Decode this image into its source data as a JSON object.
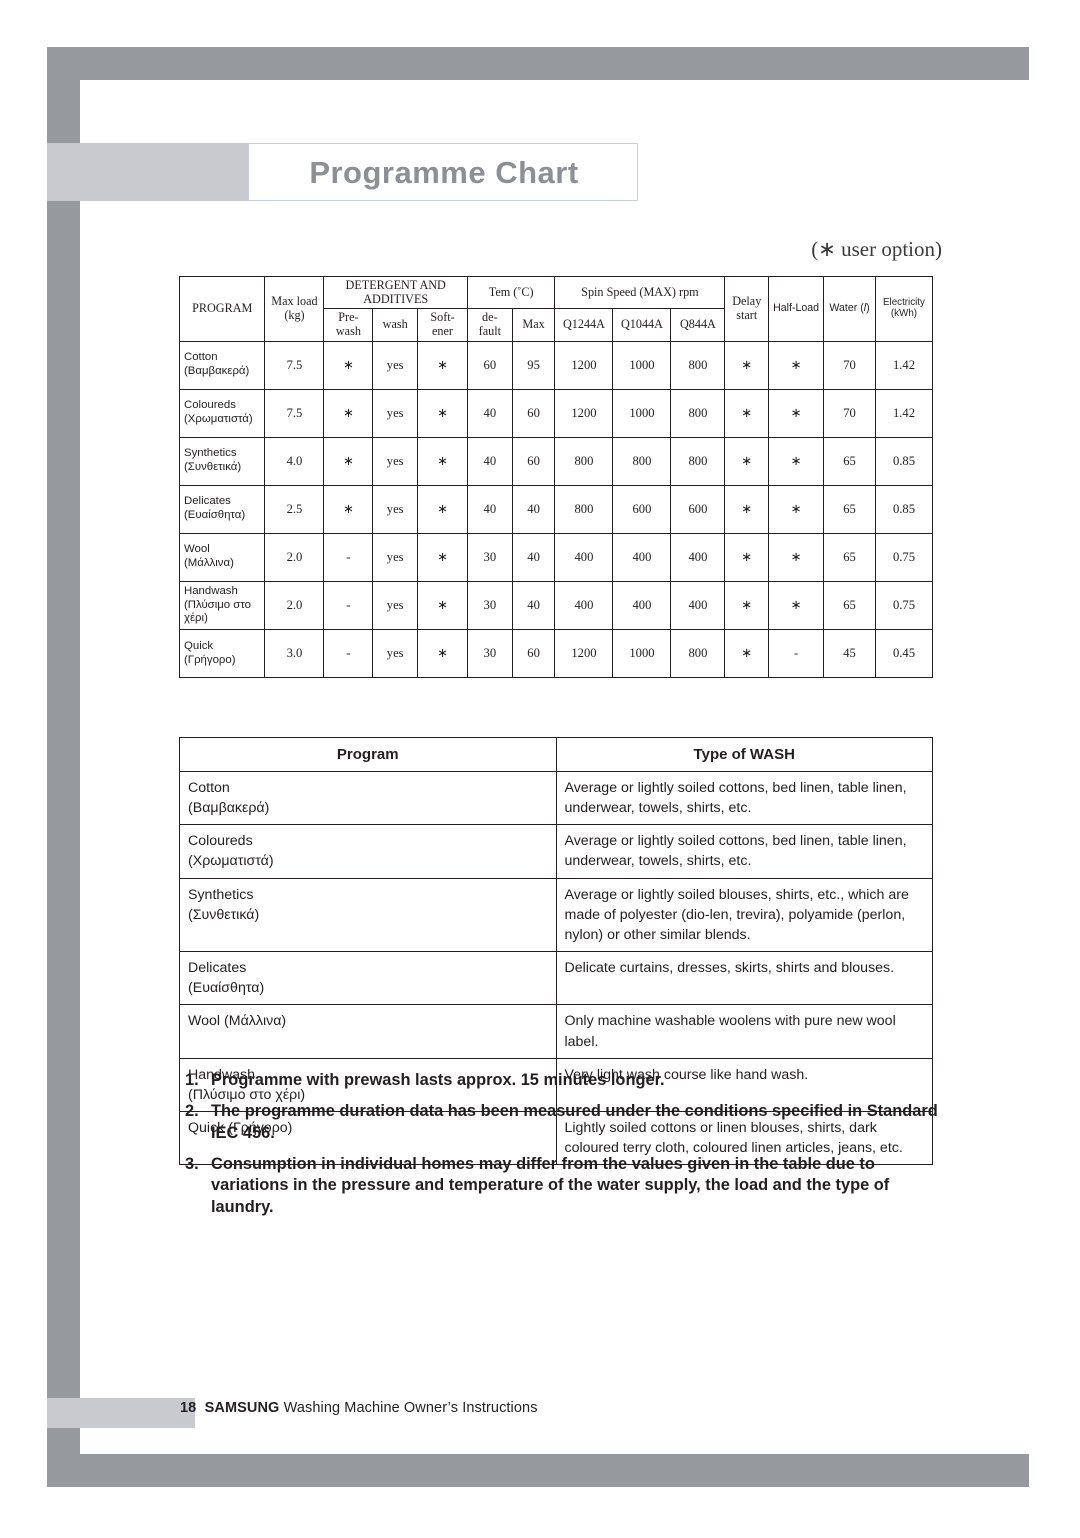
{
  "page": {
    "title": "Programme Chart",
    "user_option_note": "(∗ user option)",
    "footer_page_number": "18",
    "footer_brand": "SAMSUNG",
    "footer_text": "Washing Machine Owner’s Instructions"
  },
  "chart_data": {
    "type": "table",
    "title": "Programme Chart",
    "columns": [
      "PROGRAM",
      "Max load (kg)",
      "DETERGENT AND ADDITIVES / Pre-wash",
      "DETERGENT AND ADDITIVES / wash",
      "DETERGENT AND ADDITIVES / Soft-ener",
      "Tem (˚C) / de-fault",
      "Tem (˚C) / Max",
      "Spin Speed (MAX) rpm / Q1244A",
      "Spin Speed (MAX) rpm / Q1044A",
      "Spin Speed (MAX) rpm / Q844A",
      "Delay start",
      "Half-Load",
      "Water (l)",
      "Electricity (kWh)"
    ],
    "rows": [
      {
        "program_en": "Cotton",
        "program_gr": "(Βαμβακερά)",
        "max_load": "7.5",
        "prewash": "∗",
        "wash": "yes",
        "softener": "∗",
        "temp_default": "60",
        "temp_max": "95",
        "spin_q1244a": "1200",
        "spin_q1044a": "1000",
        "spin_q844a": "800",
        "delay_start": "∗",
        "half_load": "∗",
        "water": "70",
        "electricity": "1.42"
      },
      {
        "program_en": "Coloureds",
        "program_gr": "(Χρωματιστά)",
        "max_load": "7.5",
        "prewash": "∗",
        "wash": "yes",
        "softener": "∗",
        "temp_default": "40",
        "temp_max": "60",
        "spin_q1244a": "1200",
        "spin_q1044a": "1000",
        "spin_q844a": "800",
        "delay_start": "∗",
        "half_load": "∗",
        "water": "70",
        "electricity": "1.42"
      },
      {
        "program_en": "Synthetics",
        "program_gr": "(Συνθετικά)",
        "max_load": "4.0",
        "prewash": "∗",
        "wash": "yes",
        "softener": "∗",
        "temp_default": "40",
        "temp_max": "60",
        "spin_q1244a": "800",
        "spin_q1044a": "800",
        "spin_q844a": "800",
        "delay_start": "∗",
        "half_load": "∗",
        "water": "65",
        "electricity": "0.85"
      },
      {
        "program_en": "Delicates",
        "program_gr": "(Ευαίσθητα)",
        "max_load": "2.5",
        "prewash": "∗",
        "wash": "yes",
        "softener": "∗",
        "temp_default": "40",
        "temp_max": "40",
        "spin_q1244a": "800",
        "spin_q1044a": "600",
        "spin_q844a": "600",
        "delay_start": "∗",
        "half_load": "∗",
        "water": "65",
        "electricity": "0.85"
      },
      {
        "program_en": "Wool",
        "program_gr": "(Μάλλινα)",
        "max_load": "2.0",
        "prewash": "-",
        "wash": "yes",
        "softener": "∗",
        "temp_default": "30",
        "temp_max": "40",
        "spin_q1244a": "400",
        "spin_q1044a": "400",
        "spin_q844a": "400",
        "delay_start": "∗",
        "half_load": "∗",
        "water": "65",
        "electricity": "0.75"
      },
      {
        "program_en": "Handwash",
        "program_gr": "(Πλύσιμο στο χέρι)",
        "max_load": "2.0",
        "prewash": "-",
        "wash": "yes",
        "softener": "∗",
        "temp_default": "30",
        "temp_max": "40",
        "spin_q1244a": "400",
        "spin_q1044a": "400",
        "spin_q844a": "400",
        "delay_start": "∗",
        "half_load": "∗",
        "water": "65",
        "electricity": "0.75"
      },
      {
        "program_en": "Quick",
        "program_gr": "(Γρήγορο)",
        "max_load": "3.0",
        "prewash": "-",
        "wash": "yes",
        "softener": "∗",
        "temp_default": "30",
        "temp_max": "60",
        "spin_q1244a": "1200",
        "spin_q1044a": "1000",
        "spin_q844a": "800",
        "delay_start": "∗",
        "half_load": "-",
        "water": "45",
        "electricity": "0.45"
      }
    ]
  },
  "prog_table": {
    "headers": {
      "program": "PROGRAM",
      "max_load": "Max load",
      "max_load_unit": "(kg)",
      "detergent_group": "DETERGENT AND ADDITIVES",
      "prewash": "Pre-",
      "prewash2": "wash",
      "wash": "wash",
      "softener": "Soft-",
      "softener2": "ener",
      "temp_group": "Tem (˚C)",
      "default": "de-",
      "default2": "fault",
      "max": "Max",
      "spin_group": "Spin Speed (MAX) rpm",
      "q1244a": "Q1244A",
      "q1044a": "Q1044A",
      "q844a": "Q844A",
      "delay": "Delay",
      "delay2": "start",
      "half_load": "Half-Load",
      "water": "Water (",
      "water_unit": "l",
      "water_close": ")",
      "electricity": "Electricity",
      "electricity_unit": "(kWh)"
    }
  },
  "wash_table": {
    "header_program": "Program",
    "header_type": "Type of WASH",
    "rows": [
      {
        "program_en": "Cotton",
        "program_gr": "(Βαμβακερά)",
        "inline": false,
        "description": "Average or lightly soiled cottons, bed linen, table linen, underwear, towels, shirts, etc."
      },
      {
        "program_en": "Coloureds",
        "program_gr": "(Χρωματιστά)",
        "inline": false,
        "description": "Average or lightly soiled cottons, bed linen, table linen, underwear, towels, shirts, etc."
      },
      {
        "program_en": "Synthetics",
        "program_gr": "(Συνθετικά)",
        "inline": false,
        "description": "Average or lightly soiled blouses, shirts, etc., which are made of polyester (dio-len, trevira), polyamide (perlon, nylon) or other similar blends."
      },
      {
        "program_en": "Delicates",
        "program_gr": "(Ευαίσθητα)",
        "inline": false,
        "description": "Delicate curtains, dresses, skirts, shirts and blouses."
      },
      {
        "program_en": "Wool",
        "program_gr": "(Μάλλινα)",
        "inline": true,
        "description": "Only machine washable woolens with pure new wool label."
      },
      {
        "program_en": "Handwash",
        "program_gr": "(Πλύσιμο στο χέρι)",
        "inline": false,
        "description": "Very light wash course like hand wash."
      },
      {
        "program_en": "Quick",
        "program_gr": "(Γρήγορο)",
        "inline": true,
        "description": "Lightly soiled cottons or linen blouses, shirts, dark coloured terry cloth, coloured linen articles, jeans, etc."
      }
    ]
  },
  "notes": [
    {
      "num": "1.",
      "text": "Programme with prewash lasts approx. 15 minutes longer."
    },
    {
      "num": "2.",
      "text": "The programme duration data has been measured under the conditions specified in Standard IEC 456."
    },
    {
      "num": "3.",
      "text": "Consumption in individual homes may differ from the values given in the table due to variations in the pressure and temperature of the water supply, the load and the type of laundry."
    }
  ]
}
